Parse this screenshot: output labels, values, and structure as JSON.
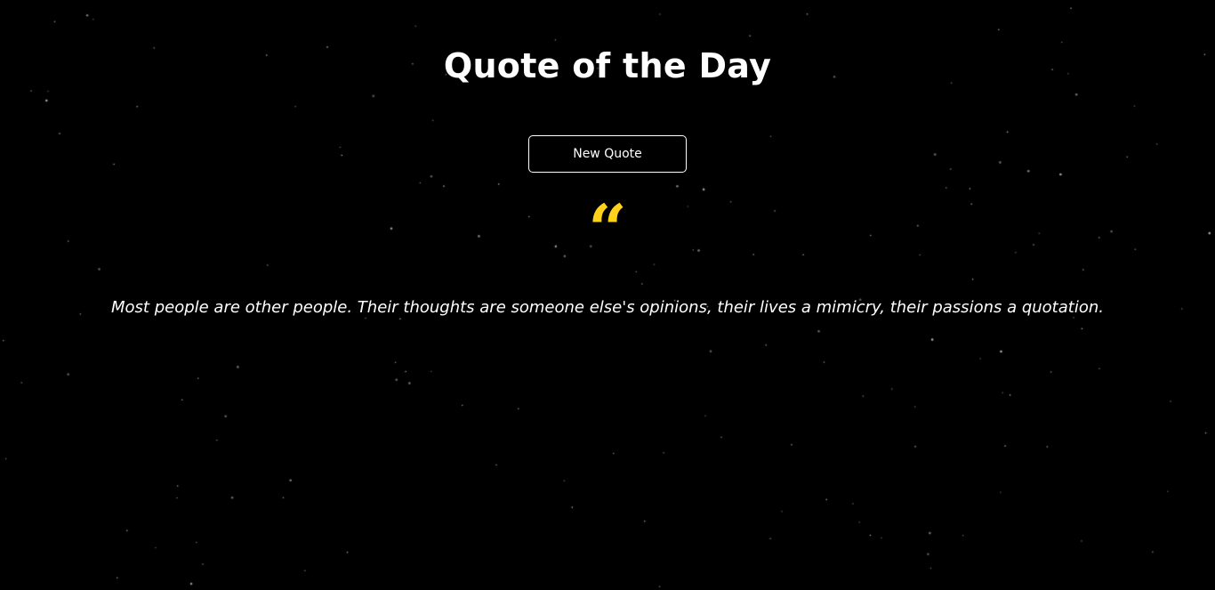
{
  "page": {
    "title": "Quote of the Day"
  },
  "controls": {
    "new_quote_label": "New Quote"
  },
  "quote": {
    "mark": "“",
    "text": "Most people are other people. Their thoughts are someone else's opinions, their lives a mimicry, their passions a quotation."
  },
  "colors": {
    "background": "#000000",
    "text": "#ffffff",
    "accent": "#ffd11a",
    "stars": "#bbbbbb"
  }
}
